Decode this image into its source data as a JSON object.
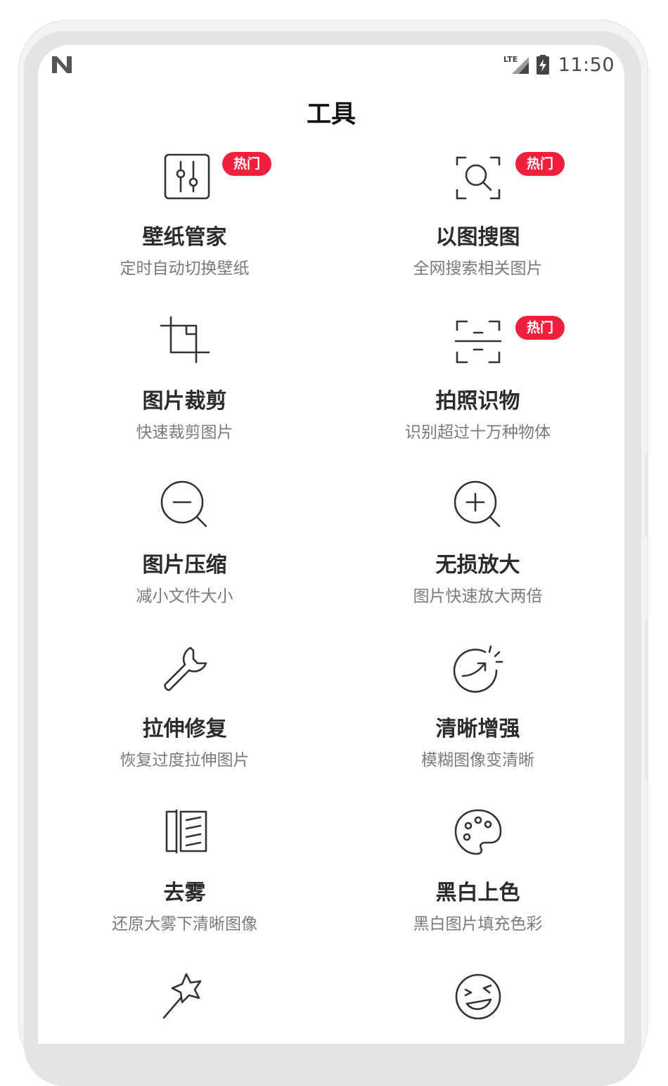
{
  "status_bar": {
    "network": "LTE",
    "time": "11:50"
  },
  "page": {
    "title": "工具"
  },
  "tools": [
    {
      "name": "壁纸管家",
      "desc": "定时自动切换壁纸",
      "badge": "热门",
      "icon": "sliders-icon"
    },
    {
      "name": "以图搜图",
      "desc": "全网搜索相关图片",
      "badge": "热门",
      "icon": "image-search-icon"
    },
    {
      "name": "图片裁剪",
      "desc": "快速裁剪图片",
      "badge": "",
      "icon": "crop-icon"
    },
    {
      "name": "拍照识物",
      "desc": "识别超过十万种物体",
      "badge": "热门",
      "icon": "scan-icon"
    },
    {
      "name": "图片压缩",
      "desc": "减小文件大小",
      "badge": "",
      "icon": "zoom-out-icon"
    },
    {
      "name": "无损放大",
      "desc": "图片快速放大两倍",
      "badge": "",
      "icon": "zoom-in-icon"
    },
    {
      "name": "拉伸修复",
      "desc": "恢复过度拉伸图片",
      "badge": "",
      "icon": "wrench-icon"
    },
    {
      "name": "清晰增强",
      "desc": "模糊图像变清晰",
      "badge": "",
      "icon": "enhance-icon"
    },
    {
      "name": "去雾",
      "desc": "还原大雾下清晰图像",
      "badge": "",
      "icon": "dehaze-icon"
    },
    {
      "name": "黑白上色",
      "desc": "黑白图片填充色彩",
      "badge": "",
      "icon": "palette-icon"
    },
    {
      "name": "",
      "desc": "",
      "badge": "",
      "icon": "magic-wand-icon"
    },
    {
      "name": "",
      "desc": "",
      "badge": "",
      "icon": "laugh-face-icon"
    }
  ]
}
